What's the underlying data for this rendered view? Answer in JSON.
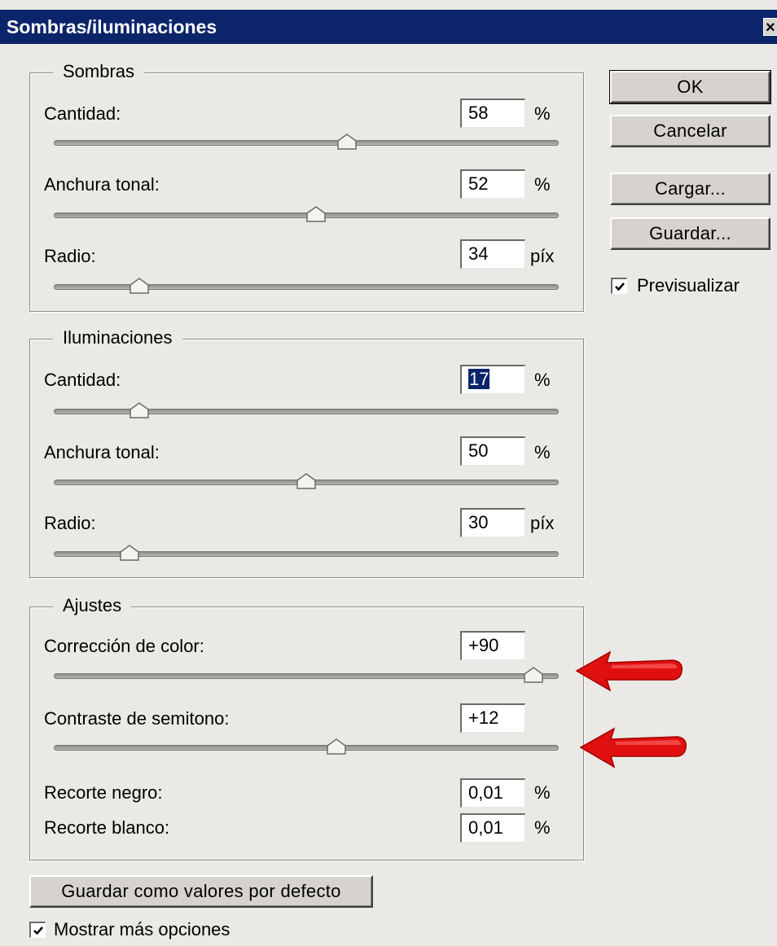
{
  "dialog": {
    "title": "Sombras/iluminaciones",
    "close_glyph": "×"
  },
  "sombras": {
    "legend": "Sombras",
    "cantidad": {
      "label": "Cantidad:",
      "value": "58",
      "unit": "%",
      "slider_fraction": 0.58
    },
    "anchura": {
      "label": "Anchura tonal:",
      "value": "52",
      "unit": "%",
      "slider_fraction": 0.52
    },
    "radio": {
      "label": "Radio:",
      "value": "34",
      "unit": "píx",
      "slider_fraction": 0.17
    }
  },
  "iluminaciones": {
    "legend": "Iluminaciones",
    "cantidad": {
      "label": "Cantidad:",
      "value": "17",
      "unit": "%",
      "slider_fraction": 0.17
    },
    "anchura": {
      "label": "Anchura tonal:",
      "value": "50",
      "unit": "%",
      "slider_fraction": 0.5
    },
    "radio": {
      "label": "Radio:",
      "value": "30",
      "unit": "píx",
      "slider_fraction": 0.15
    }
  },
  "ajustes": {
    "legend": "Ajustes",
    "correccion": {
      "label": "Corrección de color:",
      "value": "+90",
      "slider_fraction": 0.95
    },
    "contraste": {
      "label": "Contraste de semitono:",
      "value": "+12",
      "slider_fraction": 0.56
    },
    "negro": {
      "label": "Recorte negro:",
      "value": "0,01",
      "unit": "%"
    },
    "blanco": {
      "label": "Recorte blanco:",
      "value": "0,01",
      "unit": "%"
    }
  },
  "buttons": {
    "ok": "OK",
    "cancel": "Cancelar",
    "load": "Cargar...",
    "save": "Guardar...",
    "save_defaults": "Guardar como valores por defecto"
  },
  "checkboxes": {
    "preview": {
      "label": "Previsualizar",
      "checked": true
    },
    "more_options": {
      "label": "Mostrar más opciones",
      "checked": true
    }
  },
  "colors": {
    "title_bar": "#0c256a",
    "selection": "#0a246a",
    "annotation_arrow": "#e01010"
  }
}
